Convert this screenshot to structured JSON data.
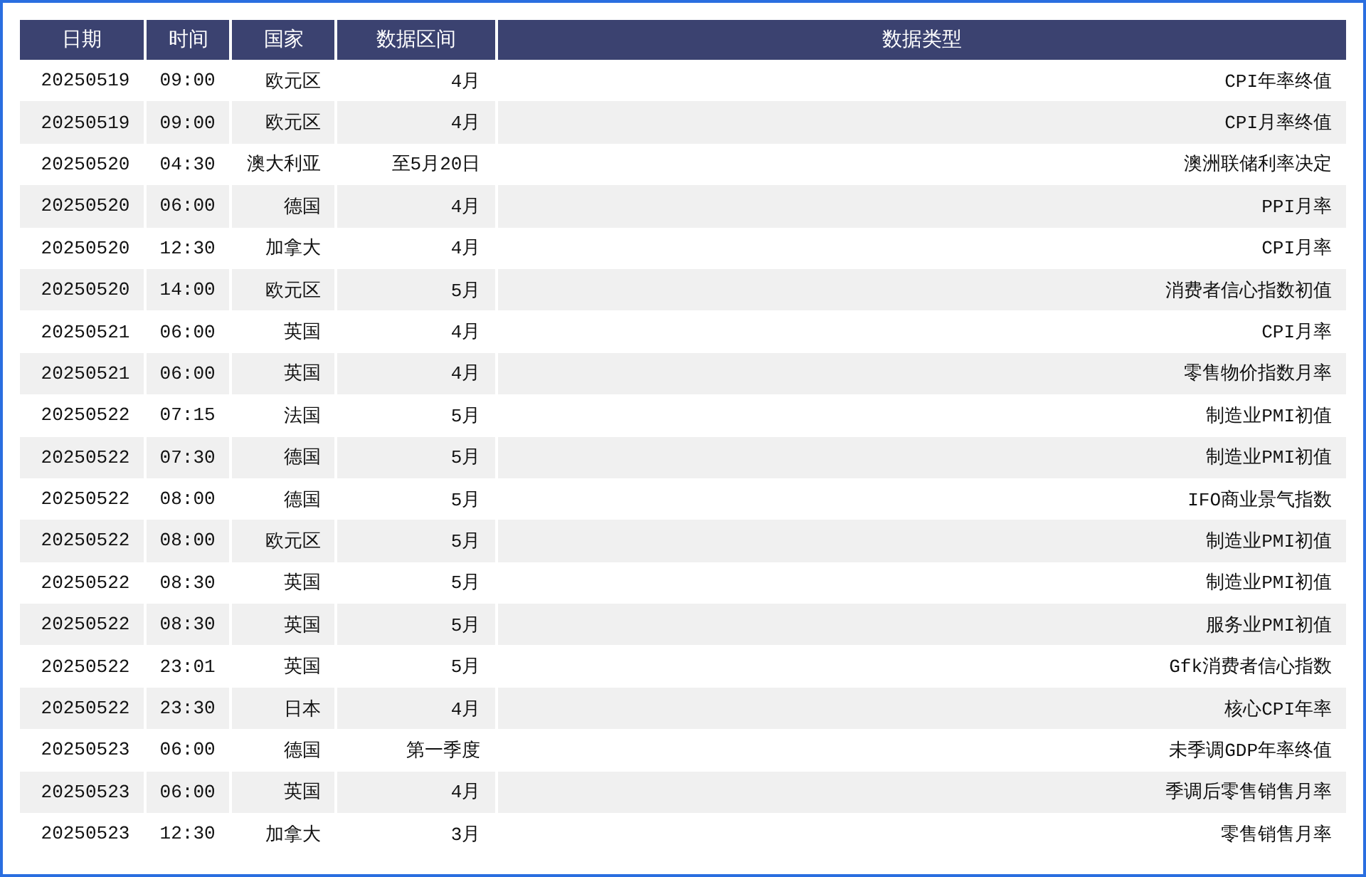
{
  "table": {
    "columns": [
      "日期",
      "时间",
      "国家",
      "数据区间",
      "数据类型"
    ],
    "rows": [
      [
        "20250519",
        "09:00",
        "欧元区",
        "4月",
        "CPI年率终值"
      ],
      [
        "20250519",
        "09:00",
        "欧元区",
        "4月",
        "CPI月率终值"
      ],
      [
        "20250520",
        "04:30",
        "澳大利亚",
        "至5月20日",
        "澳洲联储利率决定"
      ],
      [
        "20250520",
        "06:00",
        "德国",
        "4月",
        "PPI月率"
      ],
      [
        "20250520",
        "12:30",
        "加拿大",
        "4月",
        "CPI月率"
      ],
      [
        "20250520",
        "14:00",
        "欧元区",
        "5月",
        "消费者信心指数初值"
      ],
      [
        "20250521",
        "06:00",
        "英国",
        "4月",
        "CPI月率"
      ],
      [
        "20250521",
        "06:00",
        "英国",
        "4月",
        "零售物价指数月率"
      ],
      [
        "20250522",
        "07:15",
        "法国",
        "5月",
        "制造业PMI初值"
      ],
      [
        "20250522",
        "07:30",
        "德国",
        "5月",
        "制造业PMI初值"
      ],
      [
        "20250522",
        "08:00",
        "德国",
        "5月",
        "IFO商业景气指数"
      ],
      [
        "20250522",
        "08:00",
        "欧元区",
        "5月",
        "制造业PMI初值"
      ],
      [
        "20250522",
        "08:30",
        "英国",
        "5月",
        "制造业PMI初值"
      ],
      [
        "20250522",
        "08:30",
        "英国",
        "5月",
        "服务业PMI初值"
      ],
      [
        "20250522",
        "23:01",
        "英国",
        "5月",
        "Gfk消费者信心指数"
      ],
      [
        "20250522",
        "23:30",
        "日本",
        "4月",
        "核心CPI年率"
      ],
      [
        "20250523",
        "06:00",
        "德国",
        "第一季度",
        "未季调GDP年率终值"
      ],
      [
        "20250523",
        "06:00",
        "英国",
        "4月",
        "季调后零售销售月率"
      ],
      [
        "20250523",
        "12:30",
        "加拿大",
        "3月",
        "零售销售月率"
      ]
    ]
  }
}
